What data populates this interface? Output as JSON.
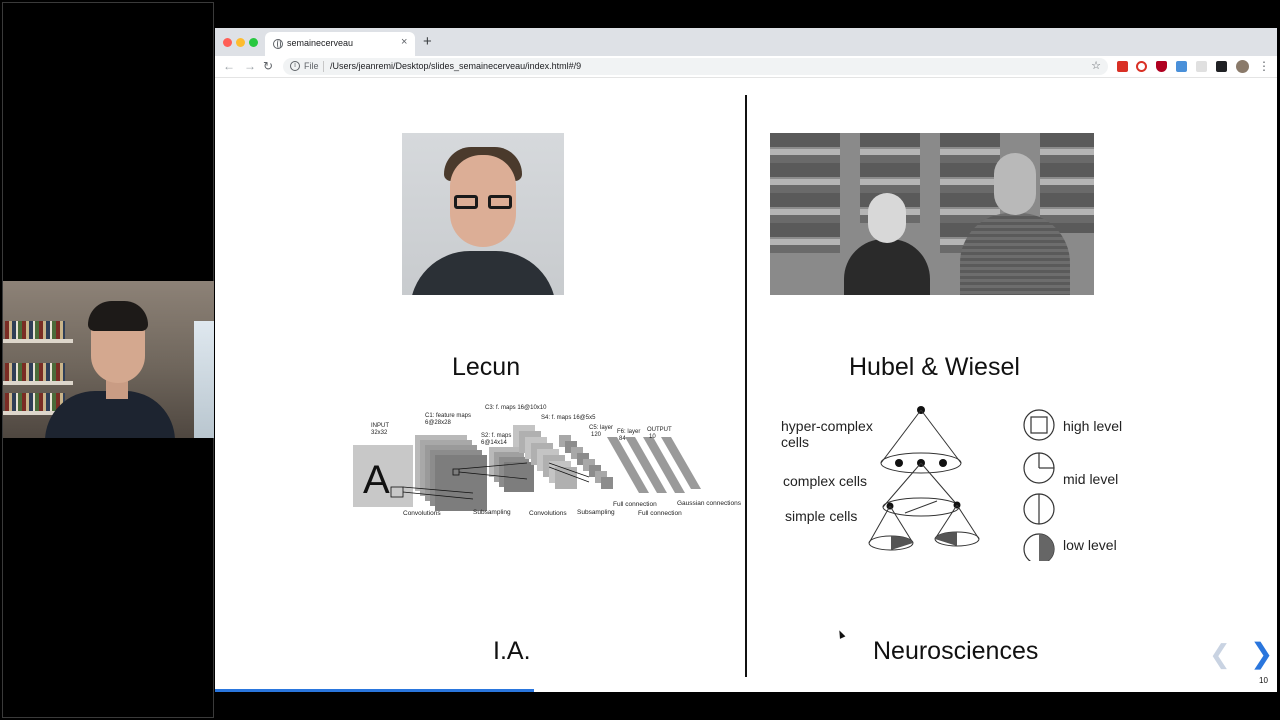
{
  "browser": {
    "tab_title": "semainecerveau",
    "tab_close": "×",
    "new_tab": "+",
    "url_scheme": "File",
    "url": "/Users/jeanremi/Desktop/slides_semainecerveau/index.html#/9"
  },
  "slide": {
    "left_name": "Lecun",
    "right_name": "Hubel & Wiesel",
    "left_label": "I.A.",
    "right_label": "Neurosciences",
    "slide_number": "10",
    "progress_fraction": 0.3
  },
  "cnn": {
    "input": "INPUT",
    "input_size": "32x32",
    "c1": "C1: feature maps",
    "c1_size": "6@28x28",
    "s2": "S2: f. maps",
    "s2_size": "6@14x14",
    "c3": "C3: f. maps 16@10x10",
    "s4": "S4: f. maps 16@5x5",
    "c5": "C5: layer",
    "c5_size": "120",
    "f6": "F6: layer",
    "f6_size": "84",
    "output": "OUTPUT",
    "output_size": "10",
    "op_conv1": "Convolutions",
    "op_sub1": "Subsampling",
    "op_conv2": "Convolutions",
    "op_sub2": "Subsampling",
    "op_full1": "Full connection",
    "op_full2": "Full connection",
    "op_gauss": "Gaussian connections",
    "letter": "A"
  },
  "hierarchy": {
    "hyper_line1": "hyper-complex",
    "hyper_line2": "cells",
    "complex": "complex cells",
    "simple": "simple cells",
    "high": "high level",
    "mid": "mid level",
    "low": "low level"
  }
}
